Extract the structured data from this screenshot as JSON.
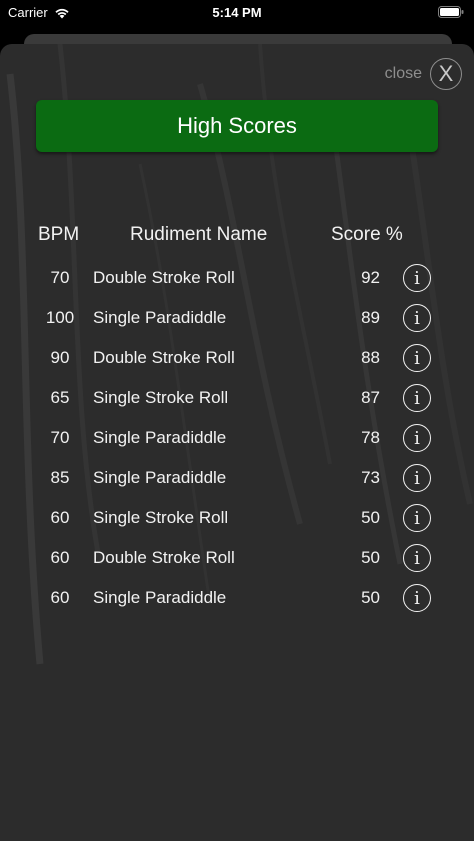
{
  "status_bar": {
    "carrier": "Carrier",
    "time": "5:14 PM"
  },
  "sheet": {
    "close_label": "close",
    "close_glyph": "X",
    "title": "High Scores"
  },
  "table": {
    "headers": {
      "bpm": "BPM",
      "name": "Rudiment Name",
      "score": "Score %"
    },
    "rows": [
      {
        "bpm": "70",
        "name": "Double Stroke Roll",
        "score": "92"
      },
      {
        "bpm": "100",
        "name": "Single Paradiddle",
        "score": "89"
      },
      {
        "bpm": "90",
        "name": "Double Stroke Roll",
        "score": "88"
      },
      {
        "bpm": "65",
        "name": "Single Stroke Roll",
        "score": "87"
      },
      {
        "bpm": "70",
        "name": "Single Paradiddle",
        "score": "78"
      },
      {
        "bpm": "85",
        "name": "Single Paradiddle",
        "score": "73"
      },
      {
        "bpm": "60",
        "name": "Single Stroke Roll",
        "score": "50"
      },
      {
        "bpm": "60",
        "name": "Double Stroke Roll",
        "score": "50"
      },
      {
        "bpm": "60",
        "name": "Single Paradiddle",
        "score": "50"
      }
    ],
    "info_glyph": "i"
  },
  "colors": {
    "title_bar": "#0b6b12",
    "sheet_background": "#2c2c2c"
  },
  "icons": [
    "wifi-icon",
    "battery-icon",
    "close-icon",
    "info-icon"
  ]
}
